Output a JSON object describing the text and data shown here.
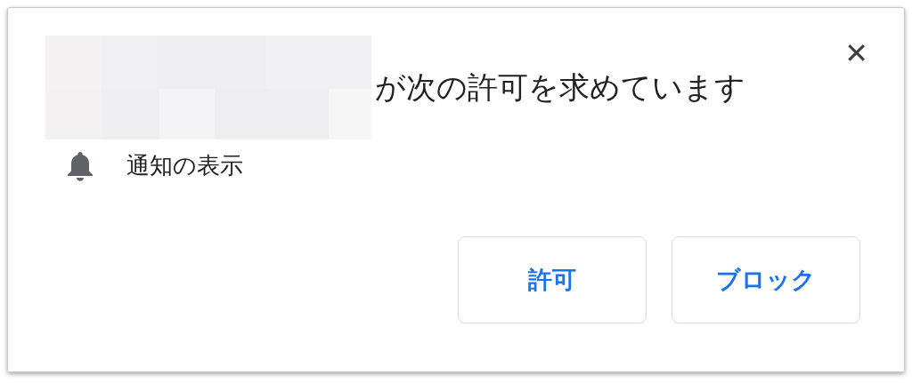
{
  "prompt": {
    "title_suffix": "が次の許可を求めています",
    "close": "✕",
    "permissions": [
      {
        "label": "通知の表示"
      }
    ],
    "buttons": [
      {
        "label": "許可"
      },
      {
        "label": "ブロック"
      }
    ]
  }
}
